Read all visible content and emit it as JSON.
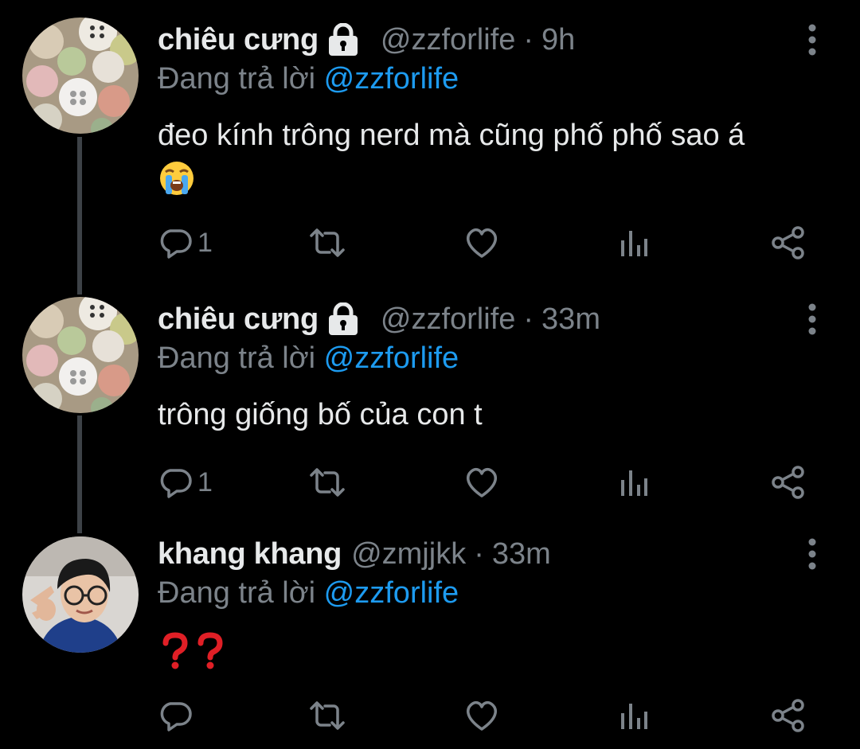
{
  "tweets": [
    {
      "display_name": "chiêu cưng",
      "handle": "@zzforlife",
      "separator": "·",
      "time": "9h",
      "replying_label": "Đang trả lời",
      "replying_to": "@zzforlife",
      "text": "đeo kính trông nerd mà cũng phố phố sao á",
      "emoji": "loudly-crying-face",
      "reply_count": "1",
      "protected": true
    },
    {
      "display_name": "chiêu cưng",
      "handle": "@zzforlife",
      "separator": "·",
      "time": "33m",
      "replying_label": "Đang trả lời",
      "replying_to": "@zzforlife",
      "text": "trông giống bố của con t",
      "reply_count": "1",
      "protected": true
    },
    {
      "display_name": "khang khang",
      "handle": "@zmjjkk",
      "separator": "·",
      "time": "33m",
      "replying_label": "Đang trả lời",
      "replying_to": "@zzforlife",
      "text": "",
      "emoji": "red-question-marks",
      "reply_count": "",
      "protected": false
    }
  ],
  "icons": {
    "protected": "lock-icon",
    "more": "more-vertical-icon",
    "reply": "reply-icon",
    "retweet": "retweet-icon",
    "like": "heart-icon",
    "views": "analytics-icon",
    "share": "share-icon"
  },
  "colors": {
    "background": "#000000",
    "primary_text": "#e7e9ea",
    "secondary_text": "#7c838a",
    "accent": "#1d9bf0",
    "thread_line": "#3d4247"
  }
}
